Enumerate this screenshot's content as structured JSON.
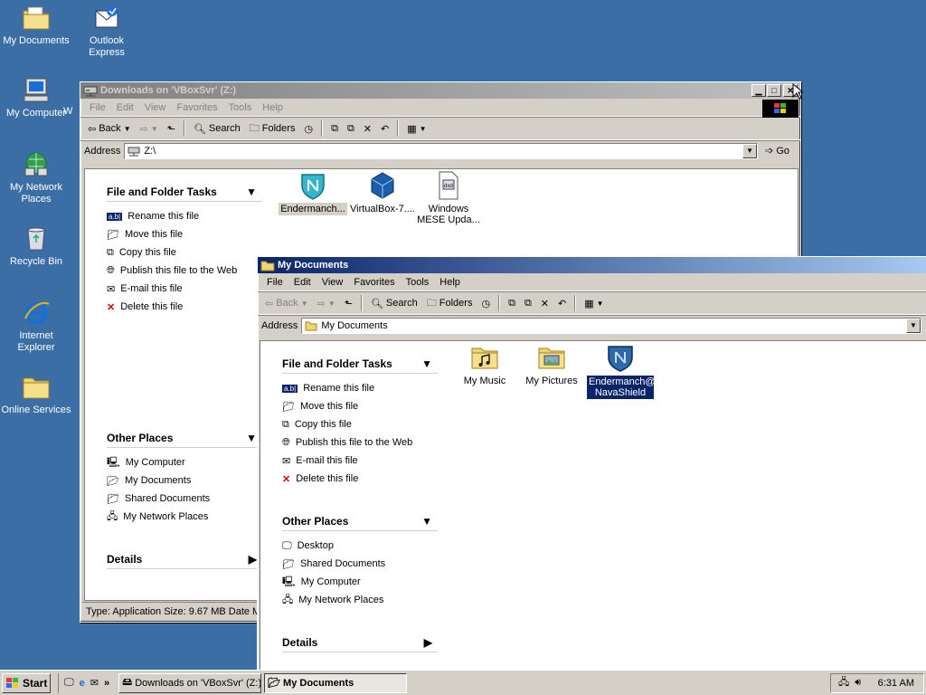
{
  "desktop": {
    "icons": [
      {
        "label": "My Documents"
      },
      {
        "label": "Outlook Express"
      },
      {
        "label": "My Computer"
      },
      {
        "label": "My Network Places"
      },
      {
        "label": "Recycle Bin"
      },
      {
        "label": "Internet Explorer"
      },
      {
        "label": "Online Services"
      }
    ],
    "partial_label": "W"
  },
  "win_downloads": {
    "title": "Downloads on 'VBoxSvr' (Z:)",
    "menu": [
      "File",
      "Edit",
      "View",
      "Favorites",
      "Tools",
      "Help"
    ],
    "toolbar": {
      "back": "Back",
      "search": "Search",
      "folders": "Folders"
    },
    "address_label": "Address",
    "address_value": "Z:\\",
    "go_label": "Go",
    "tasks_title": "File and Folder Tasks",
    "tasks": [
      "Rename this file",
      "Move this file",
      "Copy this file",
      "Publish this file to the Web",
      "E-mail this file",
      "Delete this file"
    ],
    "places_title": "Other Places",
    "places": [
      "My Computer",
      "My Documents",
      "Shared Documents",
      "My Network Places"
    ],
    "details_title": "Details",
    "files": [
      {
        "label": "Endermanch..."
      },
      {
        "label": "VirtualBox-7...."
      },
      {
        "label": "Windows MESE Upda..."
      }
    ],
    "status": "Type: Application Size: 9.67 MB Date M"
  },
  "win_mydocs": {
    "title": "My Documents",
    "menu": [
      "File",
      "Edit",
      "View",
      "Favorites",
      "Tools",
      "Help"
    ],
    "toolbar": {
      "back": "Back",
      "search": "Search",
      "folders": "Folders"
    },
    "address_label": "Address",
    "address_value": "My Documents",
    "tasks_title": "File and Folder Tasks",
    "tasks": [
      "Rename this file",
      "Move this file",
      "Copy this file",
      "Publish this file to the Web",
      "E-mail this file",
      "Delete this file"
    ],
    "places_title": "Other Places",
    "places": [
      "Desktop",
      "Shared Documents",
      "My Computer",
      "My Network Places"
    ],
    "details_title": "Details",
    "files": [
      {
        "label": "My Music"
      },
      {
        "label": "My Pictures"
      },
      {
        "label": "Endermanch@ NavaShield"
      }
    ]
  },
  "taskbar": {
    "start": "Start",
    "buttons": [
      "Downloads on 'VBoxSvr' (Z:)",
      "My Documents"
    ],
    "chevron": "»",
    "clock": "6:31 AM"
  },
  "colors": {
    "desktop": "#3a6ea5",
    "title_active": "#0a246a",
    "title_inactive": "#808080",
    "selection": "#0a246a"
  }
}
